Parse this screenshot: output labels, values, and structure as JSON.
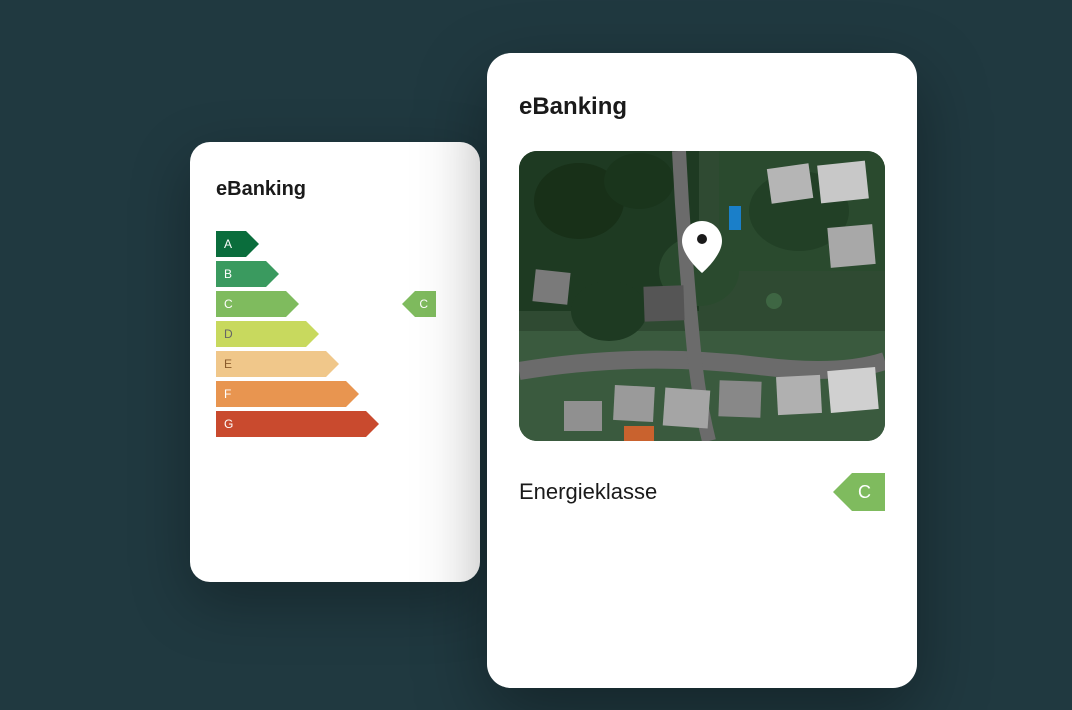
{
  "card_back": {
    "title": "eBanking",
    "energy_classes": [
      {
        "label": "A",
        "color": "#0a6d3c"
      },
      {
        "label": "B",
        "color": "#3a9a5f"
      },
      {
        "label": "C",
        "color": "#7fbb5e"
      },
      {
        "label": "D",
        "color": "#c8d95e"
      },
      {
        "label": "E",
        "color": "#f0c78a"
      },
      {
        "label": "F",
        "color": "#e89550"
      },
      {
        "label": "G",
        "color": "#c94a2e"
      }
    ],
    "current_class": "C"
  },
  "card_front": {
    "title": "eBanking",
    "energy_label": "Energieklasse",
    "energy_class": "C",
    "energy_color": "#7fbb5e"
  }
}
